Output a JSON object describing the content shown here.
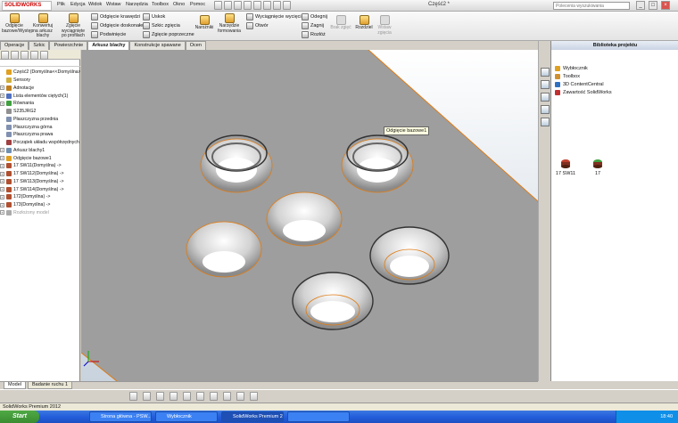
{
  "app": {
    "logo_text": "SOLIDWORKS",
    "document_title": "Część2 *",
    "search_placeholder": "Polecenia wyszukiwania"
  },
  "menu": [
    "Plik",
    "Edycja",
    "Widok",
    "Wstaw",
    "Narzędzia",
    "Toolbox",
    "Okno",
    "Pomoc"
  ],
  "ribbon": {
    "big_buttons": [
      "Odgięcie bazowe/Występ",
      "Konwertuj na arkusz blachy",
      "Zgięcie wyciągnięte po profilach"
    ],
    "col1": [
      "Odgięcie krawędzi",
      "Odgięcie doskonałe",
      "Podwinięcie"
    ],
    "col2": [
      "Uskok",
      "Szkic zgięcia",
      "Zgięcie poprzeczne"
    ],
    "narozniki": "Narożniki",
    "narzedzie": "Narzędzie formowania",
    "col3": [
      "Wyciągnięcie wycięcia",
      "Otwór"
    ],
    "col4": [
      "Odegnij",
      "Zagnij",
      "Rozłóż"
    ],
    "brak_zgiec": "Brak zgięć",
    "rozdzielenie": "Rozdziel",
    "wstaw_zgiecia": "Wstaw zgięcia"
  },
  "tabs": [
    {
      "label": "Operacje",
      "active": false
    },
    {
      "label": "Szkic",
      "active": false
    },
    {
      "label": "Powierzchnie",
      "active": false
    },
    {
      "label": "Arkusz blachy",
      "active": true
    },
    {
      "label": "Konstrukcje spawane",
      "active": false
    },
    {
      "label": "Ocen",
      "active": false
    }
  ],
  "tree": [
    {
      "label": "Część2 (Domyślna<<Domyślna>_W",
      "exp": "",
      "color": "#e0a020"
    },
    {
      "label": "Sensory",
      "exp": "",
      "color": "#d0b040"
    },
    {
      "label": "Adnotacje",
      "exp": "+",
      "color": "#c08020"
    },
    {
      "label": "Lista elementów ciętych(1)",
      "exp": "+",
      "color": "#5070c0"
    },
    {
      "label": "Równania",
      "exp": "+",
      "color": "#40a040"
    },
    {
      "label": "S235JRG2",
      "exp": "",
      "color": "#909090"
    },
    {
      "label": "Płaszczyzna przednia",
      "exp": "",
      "color": "#8090b0"
    },
    {
      "label": "Płaszczyzna górna",
      "exp": "",
      "color": "#8090b0"
    },
    {
      "label": "Płaszczyzna prawa",
      "exp": "",
      "color": "#8090b0"
    },
    {
      "label": "Początek układu współrzędnych",
      "exp": "",
      "color": "#a04040"
    },
    {
      "label": "Arkusz blachy1",
      "exp": "+",
      "color": "#7090b0"
    },
    {
      "label": "Odgięcie bazowe1",
      "exp": "+",
      "color": "#e0a020"
    },
    {
      "label": "17 SW11(Domyślna) ->",
      "exp": "+",
      "color": "#b05030"
    },
    {
      "label": "17 SW112(Domyślna) ->",
      "exp": "+",
      "color": "#b05030"
    },
    {
      "label": "17 SW113(Domyślna) ->",
      "exp": "+",
      "color": "#b05030"
    },
    {
      "label": "17 SW114(Domyślna) ->",
      "exp": "+",
      "color": "#b05030"
    },
    {
      "label": "172(Domyślna) ->",
      "exp": "+",
      "color": "#b05030"
    },
    {
      "label": "173(Domyślna) ->",
      "exp": "+",
      "color": "#b05030"
    },
    {
      "label": "Rozłożony model",
      "exp": "+",
      "color": "#aaaaaa"
    }
  ],
  "tooltip": "Odgięcie bazowe1",
  "right_pane": {
    "title": "Biblioteka projektu",
    "items": [
      "Wybłocznik",
      "Toolbox",
      "3D ContentCentral",
      "Zawartość SolidWorks"
    ],
    "parts": [
      "17 SW11",
      "17"
    ]
  },
  "bottom_tabs": [
    {
      "label": "Model",
      "active": true
    },
    {
      "label": "Badanie ruchu 1",
      "active": false
    }
  ],
  "status": "SolidWorks Premium 2012",
  "taskbar": {
    "start": "Start",
    "tasks": [
      {
        "label": "Strona główna - PSW...",
        "active": false
      },
      {
        "label": "Wybłocznik",
        "active": false
      },
      {
        "label": "SolidWorks Premium 2...",
        "active": true
      },
      {
        "label": "",
        "active": false
      }
    ],
    "clock": "18:40"
  }
}
